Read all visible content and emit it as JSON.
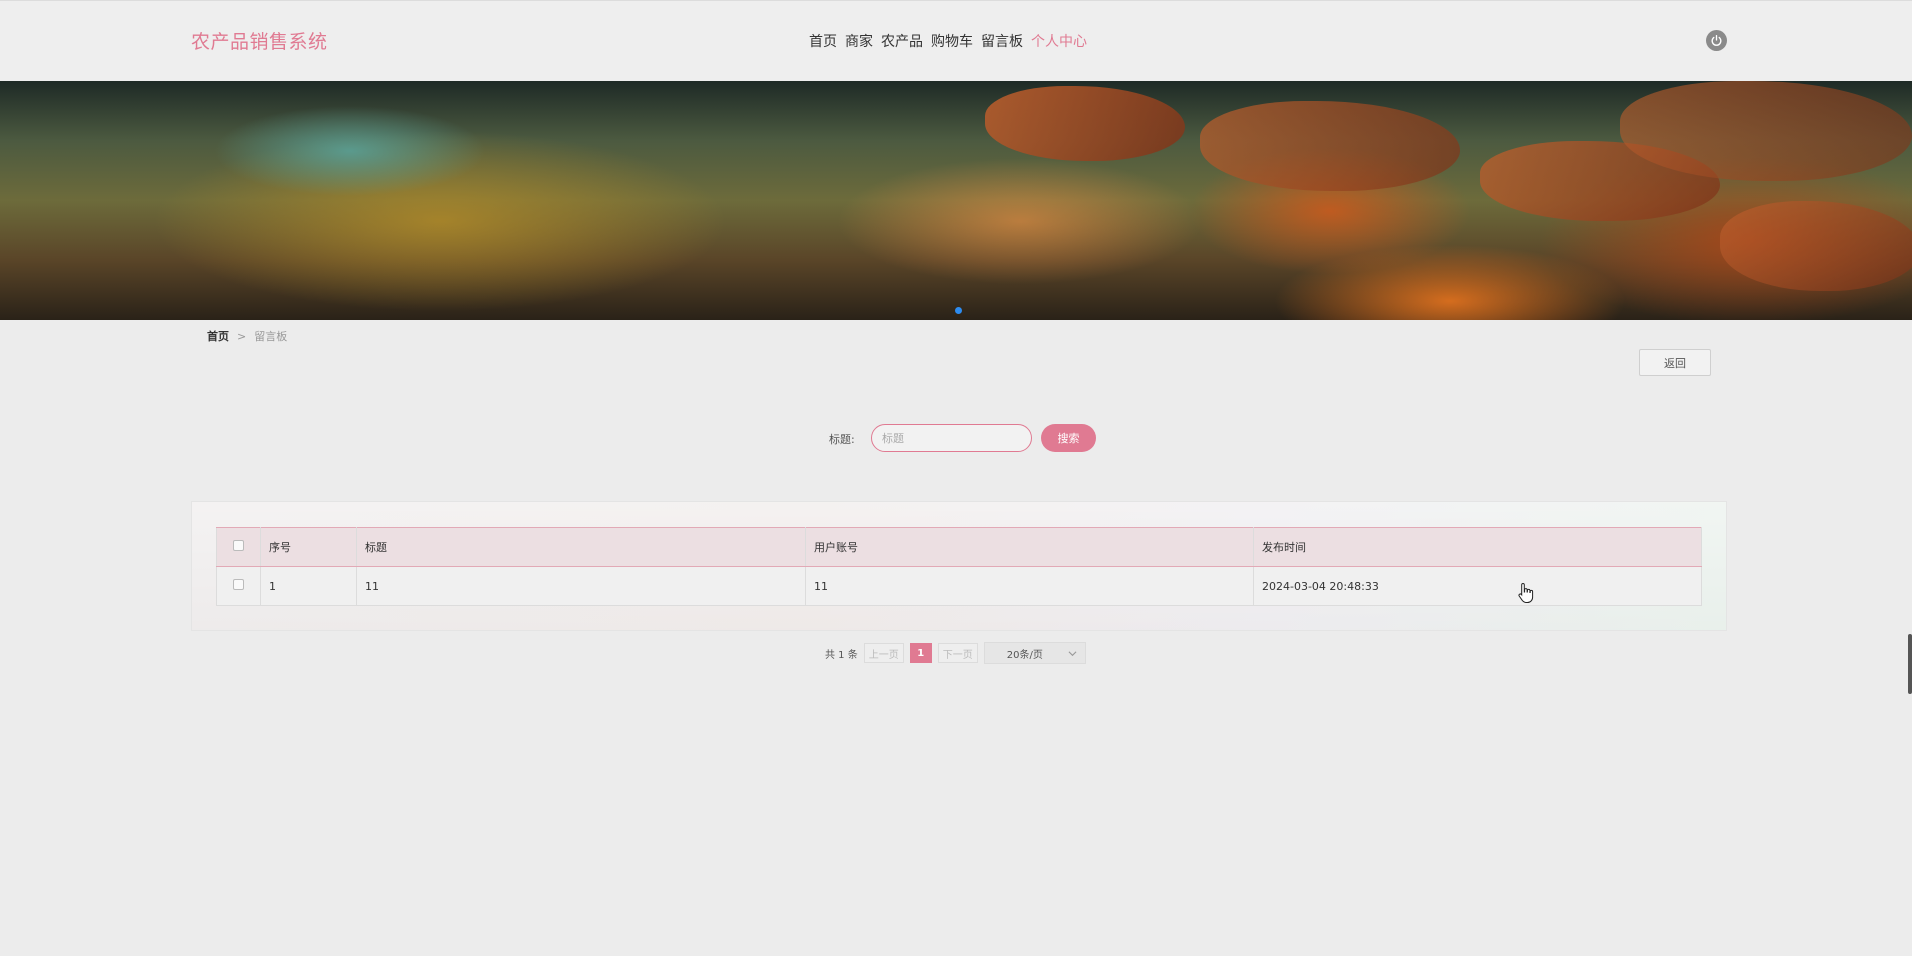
{
  "header": {
    "brand": "农产品销售系统",
    "nav": [
      "首页",
      "商家",
      "农产品",
      "购物车",
      "留言板",
      "个人中心"
    ],
    "active_nav": "个人中心",
    "logout_icon": "power-icon"
  },
  "banner": {
    "dots": 1
  },
  "breadcrumb": {
    "home": "首页",
    "sep": ">",
    "current": "留言板"
  },
  "back_button": "返回",
  "search": {
    "label": "标题:",
    "placeholder": "标题",
    "button": "搜索"
  },
  "table": {
    "headers": [
      "序号",
      "标题",
      "用户账号",
      "发布时间"
    ],
    "rows": [
      {
        "index": "1",
        "title": "11",
        "account": "11",
        "time": "2024-03-04 20:48:33"
      }
    ]
  },
  "pagination": {
    "total": "共 1 条",
    "prev": "上一页",
    "current_page": "1",
    "next": "下一页",
    "page_size": "20条/页"
  },
  "colors": {
    "accent": "#e07a92",
    "dot": "#2d8cf0"
  }
}
